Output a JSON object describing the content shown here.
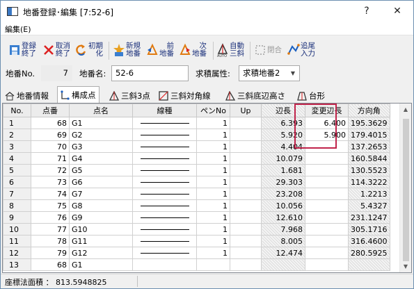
{
  "window": {
    "title": "地番登録･編集 [7:52-6]",
    "help_glyph": "?",
    "close_glyph": "✕"
  },
  "menu": {
    "edit": "編集(E)"
  },
  "toolbar": {
    "register_finish": "登録\n終了",
    "cancel_finish": "取消\n終了",
    "initialize": "初期\n化",
    "new_lot": "新規\n地番",
    "prev_lot": "前\n地番",
    "next_lot": "次\n地番",
    "auto_triangle": "自動\n三斜",
    "merge": "閉合",
    "append_input": "追尾\n入力"
  },
  "fields": {
    "lot_no_label": "地番No.",
    "lot_no_value": "7",
    "lot_name_label": "地番名:",
    "lot_name_value": "52-6",
    "area_attr_label": "求積属性:",
    "area_attr_value": "求積地番2"
  },
  "tabs": [
    "地番情報",
    "構成点",
    "三斜3点",
    "三斜対角線",
    "三斜底辺高さ",
    "台形"
  ],
  "grid": {
    "columns": [
      "No.",
      "点番",
      "点名",
      "線種",
      "ペンNo",
      "Up",
      "辺長",
      "変更辺長",
      "方向角"
    ],
    "rows": [
      {
        "no": "1",
        "pt": "68",
        "name": "G1",
        "pen": "1",
        "up": "",
        "len": "6.393",
        "chg": "6.400",
        "dir": "195.3629"
      },
      {
        "no": "2",
        "pt": "69",
        "name": "G2",
        "pen": "1",
        "up": "",
        "len": "5.920",
        "chg": "5.900",
        "dir": "179.4015"
      },
      {
        "no": "3",
        "pt": "70",
        "name": "G3",
        "pen": "1",
        "up": "",
        "len": "4.404",
        "chg": "",
        "dir": "137.2653"
      },
      {
        "no": "4",
        "pt": "71",
        "name": "G4",
        "pen": "1",
        "up": "",
        "len": "10.079",
        "chg": "",
        "dir": "160.5844"
      },
      {
        "no": "5",
        "pt": "72",
        "name": "G5",
        "pen": "1",
        "up": "",
        "len": "1.681",
        "chg": "",
        "dir": "130.5523"
      },
      {
        "no": "6",
        "pt": "73",
        "name": "G6",
        "pen": "1",
        "up": "",
        "len": "29.303",
        "chg": "",
        "dir": "114.3222"
      },
      {
        "no": "7",
        "pt": "74",
        "name": "G7",
        "pen": "1",
        "up": "",
        "len": "23.208",
        "chg": "",
        "dir": "1.2213"
      },
      {
        "no": "8",
        "pt": "75",
        "name": "G8",
        "pen": "1",
        "up": "",
        "len": "10.056",
        "chg": "",
        "dir": "5.4327"
      },
      {
        "no": "9",
        "pt": "76",
        "name": "G9",
        "pen": "1",
        "up": "",
        "len": "12.610",
        "chg": "",
        "dir": "231.1247"
      },
      {
        "no": "10",
        "pt": "77",
        "name": "G10",
        "pen": "1",
        "up": "",
        "len": "7.968",
        "chg": "",
        "dir": "305.1716"
      },
      {
        "no": "11",
        "pt": "78",
        "name": "G11",
        "pen": "1",
        "up": "",
        "len": "8.005",
        "chg": "",
        "dir": "316.4600"
      },
      {
        "no": "12",
        "pt": "79",
        "name": "G12",
        "pen": "1",
        "up": "",
        "len": "12.474",
        "chg": "",
        "dir": "280.5925"
      },
      {
        "no": "13",
        "pt": "68",
        "name": "G1",
        "pen": "",
        "up": "",
        "len": "",
        "chg": "",
        "dir": ""
      }
    ]
  },
  "status": {
    "area_text": "座標法面積 ： 813.5948825"
  },
  "colors": {
    "highlight": "#c0234a",
    "toolbar_text": "#1a2f7a",
    "window_border": "#6c8fb0"
  },
  "icons": {
    "app": "window-icon",
    "register": "check-icon",
    "cancel": "x-icon",
    "init": "refresh-icon",
    "new": "star-icon",
    "prev": "prev-lot-icon",
    "next": "next-lot-icon",
    "auto": "triangle-icon",
    "merge": "dashed-box-icon",
    "append": "polyline-icon"
  }
}
